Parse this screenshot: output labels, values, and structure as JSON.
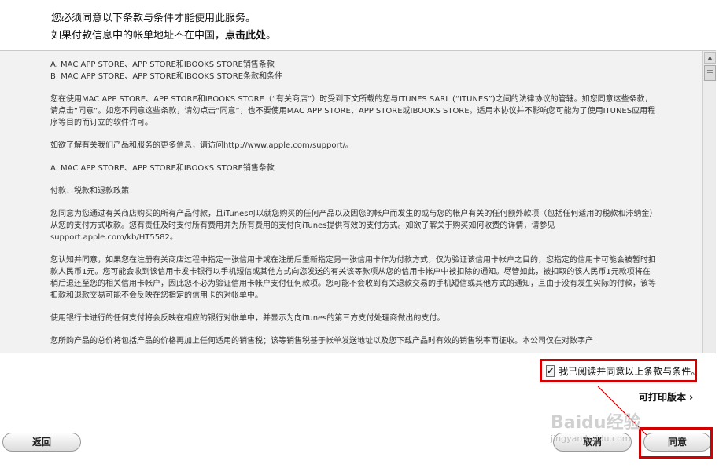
{
  "header": {
    "line1": "您必须同意以下条款与条件才能使用此服务。",
    "line2_prefix": "如果付款信息中的帐单地址不在中国，",
    "line2_link": "点击此处",
    "line2_suffix": "。"
  },
  "terms": {
    "heading_a": "A. MAC APP STORE、APP STORE和IBOOKS STORE销售条款",
    "heading_b": "B. MAC APP STORE、APP STORE和IBOOKS STORE条款和条件",
    "para1": "您在使用MAC APP STORE、APP STORE和IBOOKS STORE（“有关商店”）时受到下文所载的您与ITUNES SARL (“ITUNES”)之间的法律协议的管辖。如您同意这些条款，请点击“同意”。如您不同意这些条款，请勿点击“同意”，也不要使用MAC APP STORE、APP STORE或IBOOKS STORE。适用本协议并不影响您可能为了使用ITUNES应用程序等目的而订立的软件许可。",
    "para2": "如欲了解有关我们产品和服务的更多信息，请访问http://www.apple.com/support/。",
    "para3": "A. MAC APP STORE、APP STORE和IBOOKS STORE销售条款",
    "para4": "付款、税款和退款政策",
    "para5": "您同意为您通过有关商店购买的所有产品付款，且iTunes可以就您购买的任何产品以及因您的帐户而发生的或与您的帐户有关的任何额外款项（包括任何适用的税款和滞纳金）从您的支付方式收款。您有责任及时支付所有费用并为所有费用的支付向iTunes提供有效的支付方式。如欲了解关于购买如何收费的详情，请参见support.apple.com/kb/HT5582。",
    "para6": "您认知并同意，如果您在注册有关商店过程中指定一张信用卡或在注册后重新指定另一张信用卡作为付款方式，仅为验证该信用卡帐户之目的，您指定的信用卡可能会被暂时扣款人民币1元。您可能会收到该信用卡发卡银行以手机短信或其他方式向您发送的有关该等款项从您的信用卡帐户中被扣除的通知。尽管如此，被扣取的该人民币1元款项将在稍后退还至您的相关信用卡帐户，因此您不必为验证信用卡帐户支付任何款项。您可能不会收到有关退款交易的手机短信或其他方式的通知，且由于没有发生实际的付款，该等扣款和退款交易可能不会反映在您指定的信用卡的对帐单中。",
    "para7": "使用银行卡进行的任何支付将会反映在相应的银行对帐单中，并显示为向iTunes的第三方支付处理商做出的支付。",
    "para8": "您所购产品的总价将包括产品的价格再加上任何适用的销售税；该等销售税基于帐单发送地址以及您下载产品时有效的销售税率而征收。本公司仅在对数字产"
  },
  "agree_checkbox": {
    "label": "我已阅读并同意以上条款与条件。",
    "check_mark": "✔"
  },
  "printable_link": {
    "label": "可打印版本",
    "chevron": "›"
  },
  "buttons": {
    "back": "返回",
    "cancel": "取消",
    "agree": "同意"
  },
  "watermark": {
    "big": "Baidu经验",
    "small": "jingyan.baidu.com"
  },
  "colors": {
    "highlight": "#d20000",
    "panel_bg": "#f2f2f2"
  },
  "icons": {
    "scroll_up": "▲"
  }
}
